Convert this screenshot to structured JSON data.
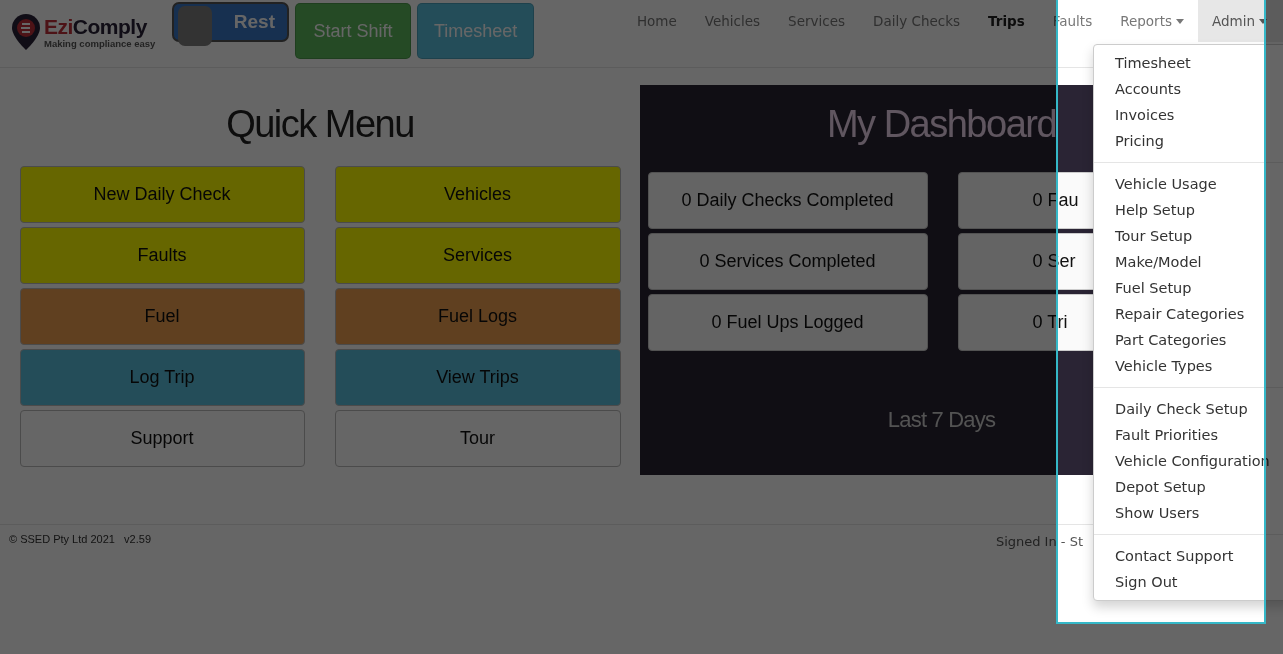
{
  "logo": {
    "brand_first": "Ezi",
    "brand_rest": "Comply",
    "tagline": "Making compliance easy"
  },
  "header_buttons": [
    {
      "kind": "toggle",
      "label": "Rest",
      "on": false
    },
    {
      "kind": "success",
      "label": "Start Shift"
    },
    {
      "kind": "info",
      "label": "Timesheet"
    }
  ],
  "nav": [
    {
      "label": "Home",
      "selected": false,
      "kind": "link"
    },
    {
      "label": "Vehicles",
      "selected": false,
      "kind": "link"
    },
    {
      "label": "Services",
      "selected": false,
      "kind": "link"
    },
    {
      "label": "Daily Checks",
      "selected": false,
      "kind": "link"
    },
    {
      "label": "Trips",
      "selected": true,
      "kind": "link"
    },
    {
      "label": "Faults",
      "selected": false,
      "kind": "link"
    },
    {
      "label": "Reports",
      "selected": false,
      "kind": "dropdown"
    },
    {
      "label": "Admin",
      "selected": true,
      "kind": "dropdown"
    }
  ],
  "quick_menu": {
    "title": "Quick Menu",
    "buttons": [
      {
        "label": "New Daily Check",
        "kind": "warning"
      },
      {
        "label": "Vehicles",
        "kind": "warning"
      },
      {
        "label": "Faults",
        "kind": "warning"
      },
      {
        "label": "Services",
        "kind": "warning"
      },
      {
        "label": "Fuel",
        "kind": "fuel"
      },
      {
        "label": "Fuel Logs",
        "kind": "fuel"
      },
      {
        "label": "Log Trip",
        "kind": "info"
      },
      {
        "label": "View Trips",
        "kind": "info"
      },
      {
        "label": "Support",
        "kind": "plain"
      },
      {
        "label": "Tour",
        "kind": "plain"
      }
    ]
  },
  "dashboard": {
    "title": "My Dashboard",
    "cards": [
      {
        "label": "0 Daily Checks Completed"
      },
      {
        "label": "0 Fau"
      },
      {
        "label": "0 Services Completed"
      },
      {
        "label": "0 Ser"
      },
      {
        "label": "0 Fuel Ups Logged"
      },
      {
        "label": "0 Tri"
      }
    ],
    "footer": "Last 7 Days"
  },
  "footer": {
    "copyright": "© SSED Pty Ltd 2021",
    "version": "v2.59",
    "signed_in": "Signed In - St"
  },
  "admin_menu": [
    [
      "Timesheet",
      "Accounts",
      "Invoices",
      "Pricing"
    ],
    [
      "Vehicle Usage",
      "Help Setup",
      "Tour Setup",
      "Make/Model",
      "Fuel Setup",
      "Repair Categories",
      "Part Categories",
      "Vehicle Types"
    ],
    [
      "Daily Check Setup",
      "Fault Priorities",
      "Vehicle Configuration",
      "Depot Setup",
      "Show Users"
    ],
    [
      "Contact Support",
      "Sign Out"
    ]
  ]
}
